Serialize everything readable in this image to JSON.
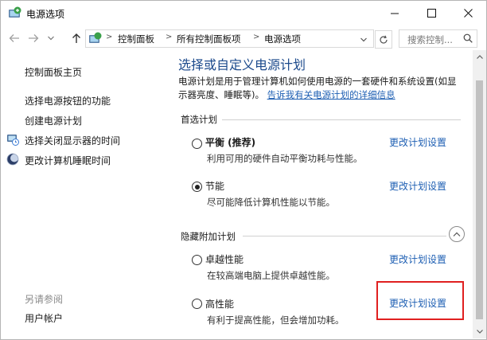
{
  "window": {
    "title": "电源选项"
  },
  "titlebar": {
    "min_glyph": "—",
    "max_glyph": "☐",
    "close_glyph": "✕"
  },
  "address": {
    "crumbs": [
      "控制面板",
      "所有控制面板项",
      "电源选项"
    ],
    "search_placeholder": "搜索控制..."
  },
  "sidebar": {
    "home": "控制面板主页",
    "links": [
      "选择电源按钮的功能",
      "创建电源计划",
      "选择关闭显示器的时间",
      "更改计算机睡眠时间"
    ],
    "see_also_title": "另请参阅",
    "see_also_links": [
      "用户帐户"
    ]
  },
  "main": {
    "heading": "选择或自定义电源计划",
    "description": "电源计划是用于管理计算机如何使用电源的一套硬件和系统设置(如显示器亮度、睡眠等)。",
    "description_link": "告诉我有关电源计划的详细信息",
    "preferred_title": "首选计划",
    "hidden_title": "隐藏附加计划",
    "change_link_label": "更改计划设置",
    "plans": [
      {
        "name": "平衡 (推荐)",
        "desc": "利用可用的硬件自动平衡功耗与性能。",
        "selected": false
      },
      {
        "name": "节能",
        "desc": "尽可能降低计算机性能以节能。",
        "selected": true
      },
      {
        "name": "卓越性能",
        "desc": "在较高端电脑上提供卓越性能。",
        "selected": false
      },
      {
        "name": "高性能",
        "desc": "有利于提高性能，但会增加功耗。",
        "selected": false
      }
    ]
  },
  "colors": {
    "heading": "#1c4a8c",
    "link": "#1e5fb3",
    "highlight": "#e02020"
  }
}
